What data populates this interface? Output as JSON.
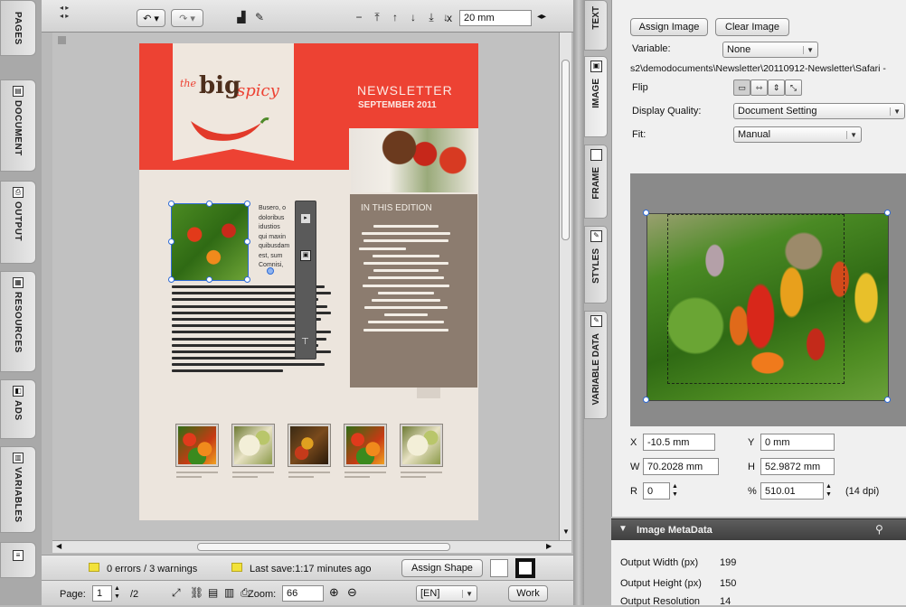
{
  "left_tabs": [
    {
      "name": "pages",
      "label": "PAGES"
    },
    {
      "name": "document",
      "label": "DOCUMENT"
    },
    {
      "name": "output",
      "label": "OUTPUT"
    },
    {
      "name": "resources",
      "label": "RESOURCES"
    },
    {
      "name": "ads",
      "label": "ADS"
    },
    {
      "name": "variables",
      "label": "VARIABLES"
    }
  ],
  "toolbar": {
    "x_label": "x",
    "offset_value": "20 mm"
  },
  "document": {
    "brand_the": "the",
    "brand_big": "big",
    "brand_spicy": "spicy",
    "newsletter_title": "NEWSLETTER",
    "newsletter_date": "SEPTEMBER 2011",
    "edition_title": "IN THIS EDITION",
    "snippet_lines": [
      "Busero, o",
      "doloribus",
      "idustios",
      "qui maxin",
      "quibusdam",
      "est, sum",
      "Comnisi,"
    ]
  },
  "status_bar": {
    "warnings": "0 errors / 3 warnings",
    "last_save": "Last save:1:17 minutes ago",
    "assign_shape": "Assign Shape"
  },
  "bottom_bar": {
    "page_label": "Page:",
    "page_value": "1",
    "page_total": "/2",
    "zoom_label": "Zoom:",
    "zoom_value": "66",
    "language": "[EN]",
    "workspace": "Work"
  },
  "right_tabs": [
    {
      "name": "text",
      "label": "TEXT"
    },
    {
      "name": "image",
      "label": "IMAGE"
    },
    {
      "name": "frame",
      "label": "FRAME"
    },
    {
      "name": "styles",
      "label": "STYLES"
    },
    {
      "name": "variable-data",
      "label": "VARIABLE DATA"
    }
  ],
  "image_panel": {
    "assign_image": "Assign Image",
    "clear_image": "Clear Image",
    "variable_label": "Variable:",
    "variable_value": "None",
    "path": "s2\\demodocuments\\Newsletter\\20110912-Newsletter\\Safari -",
    "flip_label": "Flip",
    "display_quality_label": "Display Quality:",
    "display_quality_value": "Document Setting",
    "fit_label": "Fit:",
    "fit_value": "Manual",
    "x_label": "X",
    "x_value": "-10.5 mm",
    "y_label": "Y",
    "y_value": "0 mm",
    "w_label": "W",
    "w_value": "70.2028 mm",
    "h_label": "H",
    "h_value": "52.9872 mm",
    "r_label": "R",
    "r_value": "0",
    "pct_label": "%",
    "pct_value": "510.01",
    "dpi": "(14 dpi)"
  },
  "metadata": {
    "header": "Image MetaData",
    "rows": [
      {
        "label": "Output Width (px)",
        "value": "199"
      },
      {
        "label": "Output Height (px)",
        "value": "150"
      },
      {
        "label": "Output Resolution",
        "value": "14"
      }
    ]
  },
  "colors": {
    "brand_red": "#ed4233",
    "edition_brown": "#8c7c6f",
    "page_bg": "#ece5dd"
  }
}
